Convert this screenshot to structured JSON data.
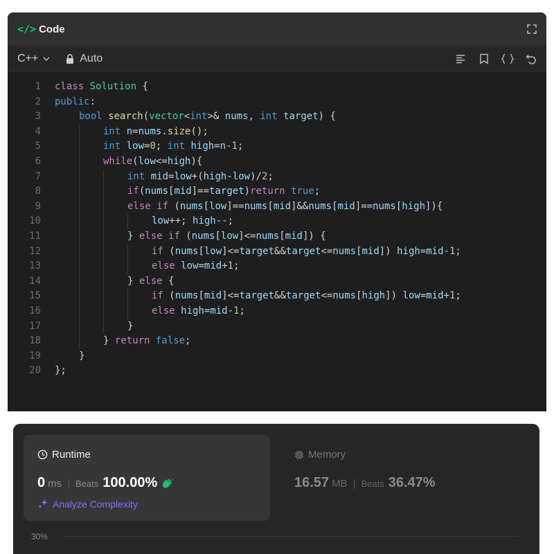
{
  "header": {
    "code_glyph": "</>",
    "title": "Code"
  },
  "toolbar": {
    "language": "C++",
    "mode": "Auto"
  },
  "editor": {
    "line_numbers": [
      "1",
      "2",
      "3",
      "4",
      "5",
      "6",
      "7",
      "8",
      "9",
      "10",
      "11",
      "12",
      "13",
      "14",
      "15",
      "16",
      "17",
      "18",
      "19",
      "20"
    ],
    "lines": [
      "class Solution {",
      "public:",
      "    bool search(vector<int>& nums, int target) {",
      "        int n=nums.size();",
      "        int low=0; int high=n-1;",
      "        while(low<=high){",
      "            int mid=low+(high-low)/2;",
      "            if(nums[mid]==target)return true;",
      "            else if (nums[low]==nums[mid]&&nums[mid]==nums[high]){",
      "                low++; high--;",
      "            } else if (nums[low]<=nums[mid]) {",
      "                if (nums[low]<=target&&target<=nums[mid]) high=mid-1;",
      "                else low=mid+1;",
      "            } else {",
      "                if (nums[mid]<=target&&target<=nums[high]) low=mid+1;",
      "                else high=mid-1;",
      "            }",
      "        } return false;",
      "    }",
      "};"
    ]
  },
  "runtime": {
    "title": "Runtime",
    "value": "0",
    "unit": "ms",
    "beats_label": "Beats",
    "beats_value": "100.00%",
    "analyze_label": "Analyze Complexity"
  },
  "memory": {
    "title": "Memory",
    "value": "16.57",
    "unit": "MB",
    "beats_label": "Beats",
    "beats_value": "36.47%"
  },
  "chart": {
    "y_tick": "30%"
  },
  "colors": {
    "accent_green": "#14c56b",
    "analyze_purple": "#8c6cf5",
    "keyword": "#c586c0",
    "type": "#569cd6"
  }
}
